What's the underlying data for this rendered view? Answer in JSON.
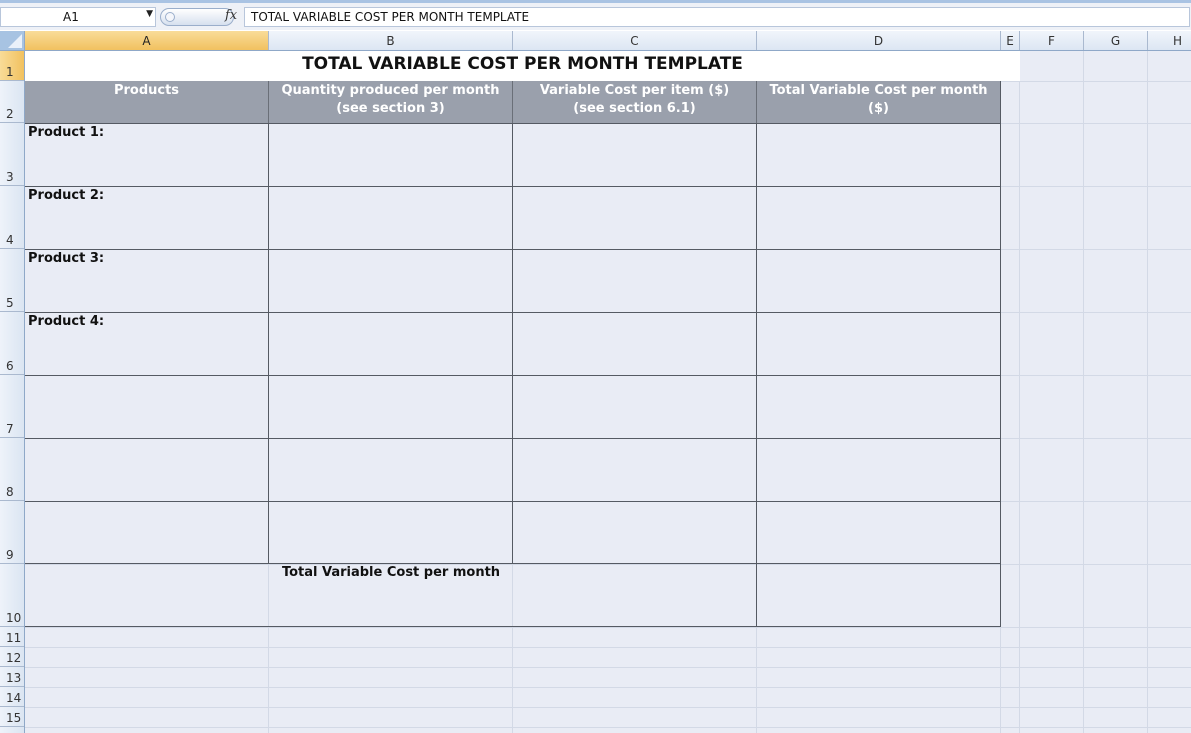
{
  "formula_bar": {
    "name_box": "A1",
    "fx_label": "fx",
    "formula": "TOTAL VARIABLE COST PER MONTH TEMPLATE"
  },
  "columns": [
    "A",
    "B",
    "C",
    "D",
    "E",
    "F",
    "G",
    "H"
  ],
  "rows": [
    "1",
    "2",
    "3",
    "4",
    "5",
    "6",
    "7",
    "8",
    "9",
    "10",
    "11",
    "12",
    "13",
    "14",
    "15"
  ],
  "sheet": {
    "title": "TOTAL VARIABLE COST PER MONTH TEMPLATE",
    "headers": {
      "products": "Products",
      "quantity_line1": "Quantity produced per month",
      "quantity_line2": "(see section 3)",
      "variable_line1": "Variable Cost per item ($)",
      "variable_line2": "(see section 6.1)",
      "total": "Total Variable Cost per month ($)"
    },
    "products": [
      "Product 1:",
      "Product 2:",
      "Product 3:",
      "Product 4:"
    ],
    "total_label": "Total Variable Cost per month"
  }
}
